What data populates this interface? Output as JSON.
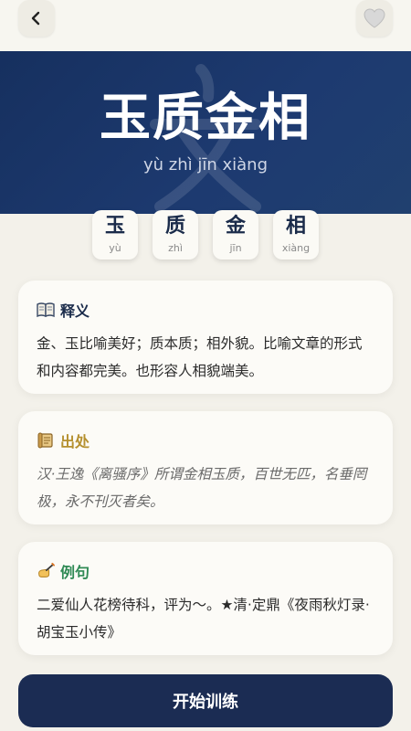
{
  "header": {
    "back_icon": "chevron-left-icon",
    "favorite_icon": "heart-icon"
  },
  "hero": {
    "title": "玉质金相",
    "pinyin": "yù zhì jīn xiàng"
  },
  "characters": [
    {
      "hanzi": "玉",
      "pinyin": "yù"
    },
    {
      "hanzi": "质",
      "pinyin": "zhì"
    },
    {
      "hanzi": "金",
      "pinyin": "jīn"
    },
    {
      "hanzi": "相",
      "pinyin": "xiàng"
    }
  ],
  "meaning": {
    "icon": "book-icon",
    "title": "释义",
    "text": "金、玉比喻美好；质本质；相外貌。比喻文章的形式和内容都完美。也形容人相貌端美。"
  },
  "source": {
    "icon": "scroll-icon",
    "title": "出处",
    "text": "汉·王逸《离骚序》所谓金相玉质，百世无匹，名垂罔极，永不刊灭者矣。"
  },
  "example": {
    "icon": "writing-hand-icon",
    "title": "例句",
    "text": "二爱仙人花榜待科，评为～。★清·定鼎《夜雨秋灯录·胡宝玉小传》"
  },
  "actions": {
    "start_label": "开始训练"
  },
  "colors": {
    "hero_bg": "#1d3a70",
    "meaning_title": "#1a2b4a",
    "source_title": "#b5902f",
    "example_title": "#2f8a55",
    "button_bg": "#1b2c53",
    "page_bg": "#f3f1ea"
  }
}
